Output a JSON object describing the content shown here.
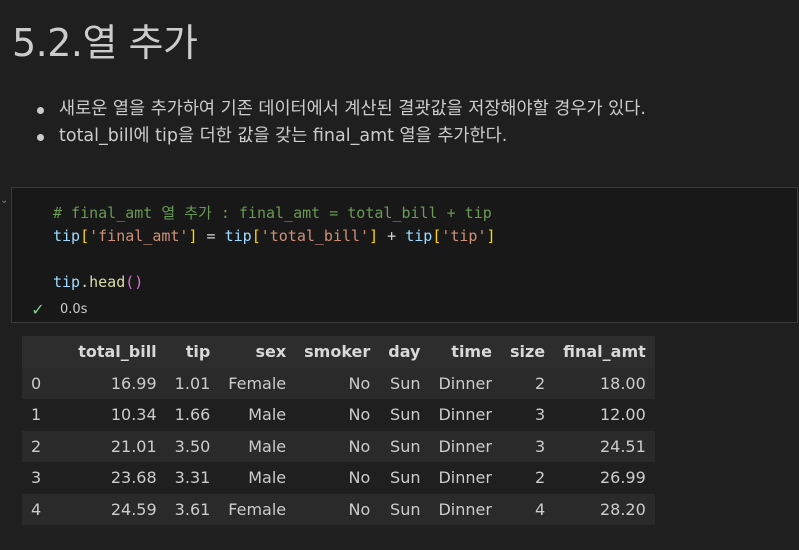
{
  "heading": "5.2.열 추가",
  "bullets": [
    "새로운 열을 추가하여 기존 데이터에서 계산된 결괏값을 저장해야할 경우가 있다.",
    "total_bill에 tip을 더한 값을 갖는 final_amt 열을 추가한다."
  ],
  "code": {
    "comment": "# final_amt 열 추가 : final_amt = total_bill + tip",
    "line2": {
      "v1": "tip",
      "b1": "[",
      "s1": "'final_amt'",
      "b1c": "]",
      "eq": " = ",
      "v2": "tip",
      "b2": "[",
      "s2": "'total_bill'",
      "b2c": "]",
      "plus": " + ",
      "v3": "tip",
      "b3": "[",
      "s3": "'tip'",
      "b3c": "]"
    },
    "line4": {
      "v": "tip",
      "dot": ".",
      "f": "head",
      "p": "()"
    }
  },
  "status": {
    "icon": "check-icon",
    "time": "0.0s"
  },
  "table": {
    "columns": [
      "total_bill",
      "tip",
      "sex",
      "smoker",
      "day",
      "time",
      "size",
      "final_amt"
    ],
    "rows": [
      {
        "index": "0",
        "cells": [
          "16.99",
          "1.01",
          "Female",
          "No",
          "Sun",
          "Dinner",
          "2",
          "18.00"
        ]
      },
      {
        "index": "1",
        "cells": [
          "10.34",
          "1.66",
          "Male",
          "No",
          "Sun",
          "Dinner",
          "3",
          "12.00"
        ]
      },
      {
        "index": "2",
        "cells": [
          "21.01",
          "3.50",
          "Male",
          "No",
          "Sun",
          "Dinner",
          "3",
          "24.51"
        ]
      },
      {
        "index": "3",
        "cells": [
          "23.68",
          "3.31",
          "Male",
          "No",
          "Sun",
          "Dinner",
          "2",
          "26.99"
        ]
      },
      {
        "index": "4",
        "cells": [
          "24.59",
          "3.61",
          "Female",
          "No",
          "Sun",
          "Dinner",
          "4",
          "28.20"
        ]
      }
    ]
  }
}
